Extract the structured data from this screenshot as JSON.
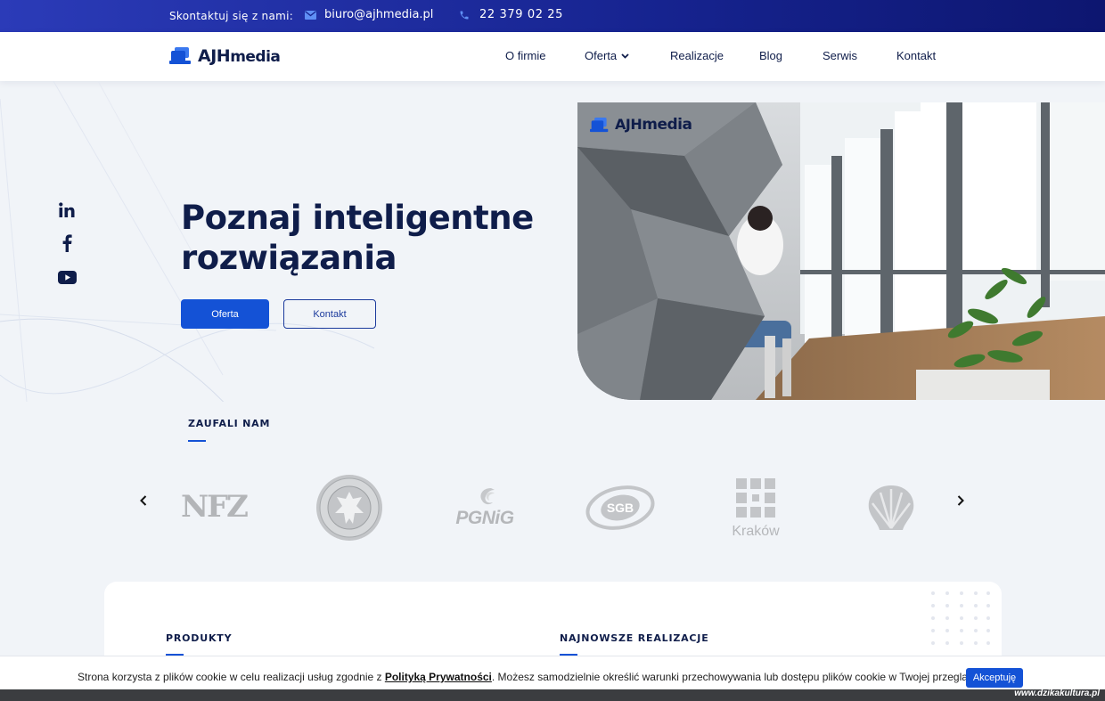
{
  "topbar": {
    "contact_label": "Skontaktuj się z nami:",
    "email": "biuro@ajhmedia.pl",
    "phone": "22 379 02 25"
  },
  "brand": {
    "logo_bold": "AJH",
    "logo_light": "media"
  },
  "nav": {
    "items": [
      "O firmie",
      "Oferta",
      "Realizacje",
      "Blog",
      "Serwis",
      "Kontakt"
    ]
  },
  "hero": {
    "title_line1": "Poznaj inteligentne",
    "title_line2": "rozwiązania",
    "btn_primary": "Oferta",
    "btn_secondary": "Kontakt"
  },
  "social": [
    "linkedin-icon",
    "facebook-icon",
    "youtube-icon"
  ],
  "trusted": {
    "label": "ZAUFALI NAM",
    "logos": [
      {
        "name": "NFZ",
        "text": "NFZ"
      },
      {
        "name": "Uniwersytet Medyczny w Lublinie",
        "text": ""
      },
      {
        "name": "PGNiG",
        "text": "PGNiG"
      },
      {
        "name": "SGB",
        "text": "SGB"
      },
      {
        "name": "Kraków",
        "text": "Kraków"
      },
      {
        "name": "Shell",
        "text": ""
      }
    ]
  },
  "sections": {
    "products": "PRODUKTY",
    "latest": "NAJNOWSZE REALIZACJE"
  },
  "cookie": {
    "text_before": "Strona korzysta z plików cookie w celu realizacji usług zgodnie z ",
    "link": "Polityką Prywatności",
    "text_after": ". Możesz samodzielnie określić warunki przechowywania lub dostępu plików cookie w Twojej przeglądarce.",
    "accept": "Akceptuję"
  },
  "watermark": "www.dzikakultura.pl",
  "colors": {
    "accent": "#1452d6",
    "navy": "#0f1d4a",
    "topbar": "#16238f"
  }
}
